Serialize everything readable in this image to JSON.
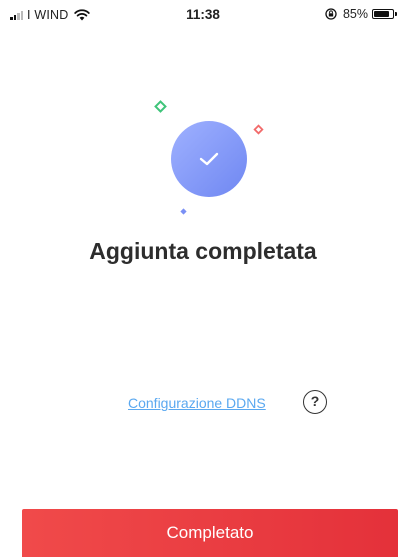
{
  "status_bar": {
    "carrier": "I WIND",
    "time": "11:38",
    "battery": "85%",
    "battery_level": 0.85
  },
  "main": {
    "title": "Aggiunta completata",
    "ddns_link": "Configurazione DDNS",
    "help_icon_glyph": "?"
  },
  "footer": {
    "done_label": "Completato"
  },
  "icons": {
    "success": "check-icon",
    "help": "question-icon"
  },
  "colors": {
    "accent_red": "#e8363d",
    "success_blue": "#7a90f5",
    "link_blue": "#5aa8f0",
    "deco_green": "#3fc47a",
    "deco_red": "#f26b6b"
  }
}
